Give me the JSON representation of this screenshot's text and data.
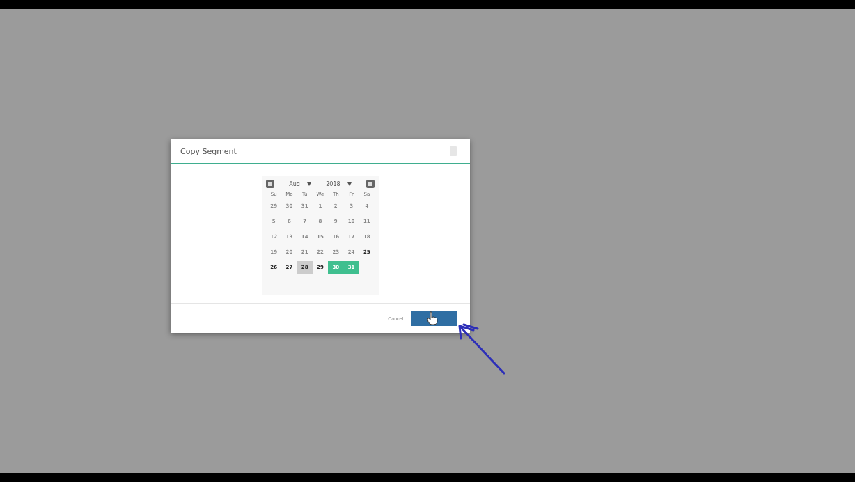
{
  "dialog": {
    "title": "Copy Segment",
    "calendar": {
      "month": "Aug",
      "year": "2018",
      "weekdays": [
        "Su",
        "Mo",
        "Tu",
        "We",
        "Th",
        "Fr",
        "Sa"
      ],
      "weeks": [
        [
          {
            "label": "29",
            "disabled": true,
            "selected": false,
            "today": false
          },
          {
            "label": "30",
            "disabled": true,
            "selected": false,
            "today": false
          },
          {
            "label": "31",
            "disabled": true,
            "selected": false,
            "today": false
          },
          {
            "label": "1",
            "disabled": true,
            "selected": false,
            "today": false
          },
          {
            "label": "2",
            "disabled": true,
            "selected": false,
            "today": false
          },
          {
            "label": "3",
            "disabled": true,
            "selected": false,
            "today": false
          },
          {
            "label": "4",
            "disabled": true,
            "selected": false,
            "today": false
          }
        ],
        [
          {
            "label": "5",
            "disabled": true,
            "selected": false,
            "today": false
          },
          {
            "label": "6",
            "disabled": true,
            "selected": false,
            "today": false
          },
          {
            "label": "7",
            "disabled": true,
            "selected": false,
            "today": false
          },
          {
            "label": "8",
            "disabled": true,
            "selected": false,
            "today": false
          },
          {
            "label": "9",
            "disabled": true,
            "selected": false,
            "today": false
          },
          {
            "label": "10",
            "disabled": true,
            "selected": false,
            "today": false
          },
          {
            "label": "11",
            "disabled": true,
            "selected": false,
            "today": false
          }
        ],
        [
          {
            "label": "12",
            "disabled": true,
            "selected": false,
            "today": false
          },
          {
            "label": "13",
            "disabled": true,
            "selected": false,
            "today": false
          },
          {
            "label": "14",
            "disabled": true,
            "selected": false,
            "today": false
          },
          {
            "label": "15",
            "disabled": true,
            "selected": false,
            "today": false
          },
          {
            "label": "16",
            "disabled": true,
            "selected": false,
            "today": false
          },
          {
            "label": "17",
            "disabled": true,
            "selected": false,
            "today": false
          },
          {
            "label": "18",
            "disabled": true,
            "selected": false,
            "today": false
          }
        ],
        [
          {
            "label": "19",
            "disabled": true,
            "selected": false,
            "today": false
          },
          {
            "label": "20",
            "disabled": true,
            "selected": false,
            "today": false
          },
          {
            "label": "21",
            "disabled": true,
            "selected": false,
            "today": false
          },
          {
            "label": "22",
            "disabled": true,
            "selected": false,
            "today": false
          },
          {
            "label": "23",
            "disabled": true,
            "selected": false,
            "today": false
          },
          {
            "label": "24",
            "disabled": true,
            "selected": false,
            "today": false
          },
          {
            "label": "25",
            "disabled": false,
            "selected": false,
            "today": false
          }
        ],
        [
          {
            "label": "26",
            "disabled": false,
            "selected": false,
            "today": false
          },
          {
            "label": "27",
            "disabled": false,
            "selected": false,
            "today": false
          },
          {
            "label": "28",
            "disabled": false,
            "selected": false,
            "today": true
          },
          {
            "label": "29",
            "disabled": false,
            "selected": false,
            "today": false
          },
          {
            "label": "30",
            "disabled": false,
            "selected": true,
            "today": false
          },
          {
            "label": "31",
            "disabled": false,
            "selected": true,
            "today": false
          }
        ]
      ]
    },
    "buttons": [
      {
        "label": "Cancel",
        "kind": "link"
      },
      {
        "kind": "primary"
      }
    ]
  }
}
